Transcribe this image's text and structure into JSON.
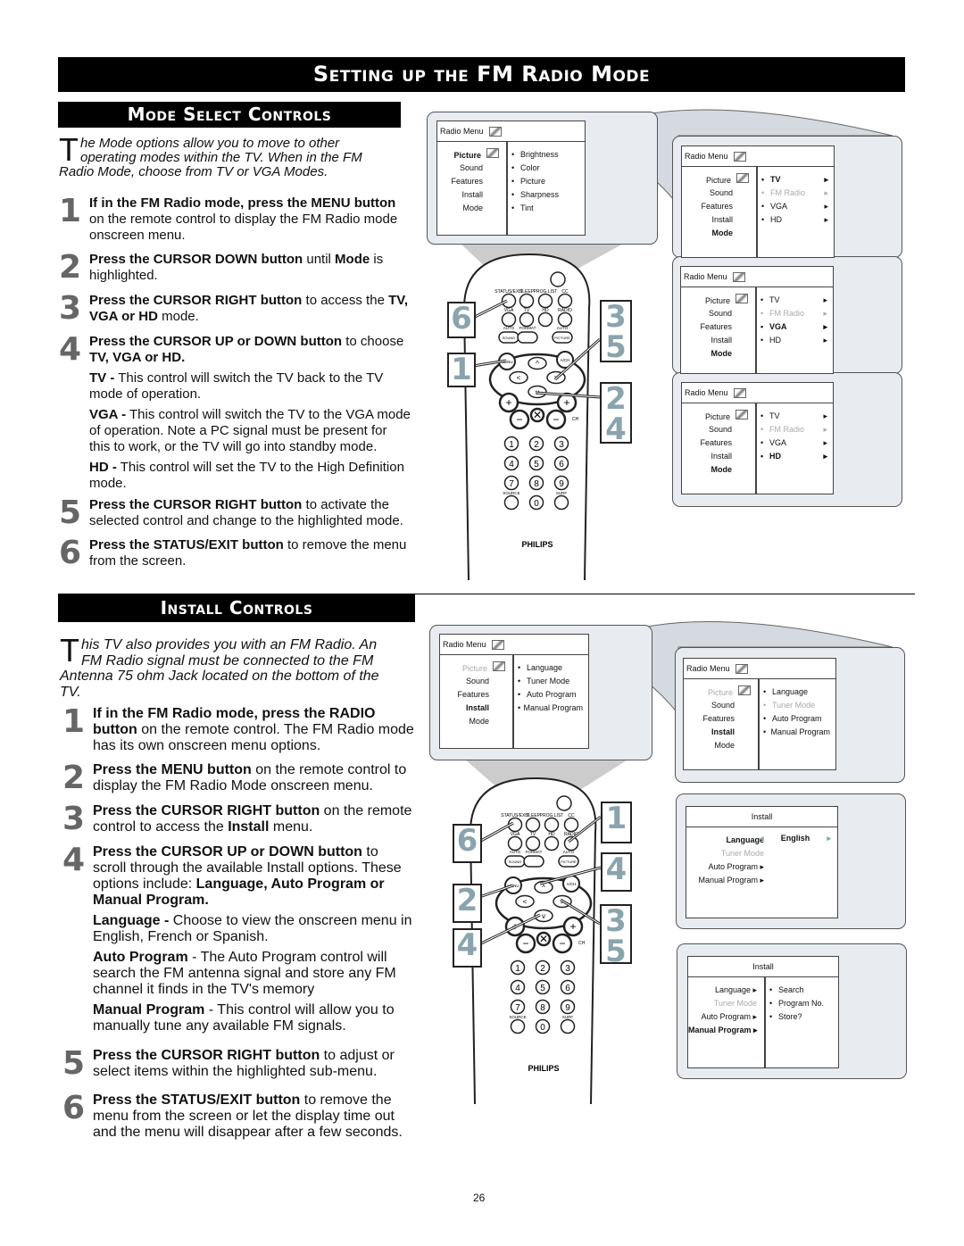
{
  "title": "Setting up the FM Radio Mode",
  "page_number": "26",
  "section1": {
    "heading": "Mode Select Controls",
    "intro_cap": "T",
    "intro": "he Mode options allow you to move to other operating modes within the TV. When in the FM Radio Mode, choose from TV or VGA Modes.",
    "steps": [
      {
        "n": "1",
        "paras": [
          [
            [
              "If in the FM Radio mode, press the MENU button",
              1
            ],
            [
              " on the remote control to display the FM Radio mode onscreen menu.",
              0
            ]
          ]
        ]
      },
      {
        "n": "2",
        "paras": [
          [
            [
              "Press the CURSOR DOWN button",
              1
            ],
            [
              " until ",
              0
            ],
            [
              "Mode",
              1
            ],
            [
              " is highlighted.",
              0
            ]
          ]
        ]
      },
      {
        "n": "3",
        "paras": [
          [
            [
              "Press the CURSOR RIGHT button",
              1
            ],
            [
              " to access the ",
              0
            ],
            [
              "TV, VGA or HD",
              1
            ],
            [
              " mode.",
              0
            ]
          ]
        ]
      },
      {
        "n": "4",
        "paras": [
          [
            [
              "Press the CURSOR UP or DOWN button",
              1
            ],
            [
              " to choose ",
              0
            ],
            [
              "TV, VGA or HD.",
              1
            ]
          ],
          [
            [
              "TV -",
              1
            ],
            [
              " This control will switch the TV back to the TV mode of operation.",
              0
            ]
          ],
          [
            [
              "VGA -",
              1
            ],
            [
              " This control will switch the TV  to the VGA mode of operation. Note a PC signal must be present for this to work, or the TV will go into standby mode.",
              0
            ]
          ],
          [
            [
              "HD -",
              1
            ],
            [
              " This control will set the TV to the High Definition mode.",
              0
            ]
          ]
        ]
      },
      {
        "n": "5",
        "paras": [
          [
            [
              "Press the CURSOR RIGHT button",
              1
            ],
            [
              " to activate the selected control and change to the highlighted mode.",
              0
            ]
          ]
        ]
      },
      {
        "n": "6",
        "paras": [
          [
            [
              "Press the STATUS/EXIT button",
              1
            ],
            [
              " to remove the menu from the screen.",
              0
            ]
          ]
        ]
      }
    ]
  },
  "section2": {
    "heading": "Install Controls",
    "intro_cap": "T",
    "intro": "his TV also provides you with an FM Radio. An FM Radio signal must be connected to the FM Antenna 75 ohm Jack located on the bottom of the TV.",
    "steps": [
      {
        "n": "1",
        "paras": [
          [
            [
              "If in the FM Radio mode, press the RADIO button",
              1
            ],
            [
              " on the remote control. The FM Radio mode has its own onscreen menu options.",
              0
            ]
          ]
        ]
      },
      {
        "n": "2",
        "paras": [
          [
            [
              "Press the MENU button",
              1
            ],
            [
              " on the remote control to display the FM Radio Mode onscreen menu.",
              0
            ]
          ]
        ]
      },
      {
        "n": "3",
        "paras": [
          [
            [
              "Press the CURSOR RIGHT button",
              1
            ],
            [
              " on the remote control to access the ",
              0
            ],
            [
              "Install",
              1
            ],
            [
              " menu.",
              0
            ]
          ]
        ]
      },
      {
        "n": "4",
        "paras": [
          [
            [
              "Press the CURSOR UP or DOWN button",
              1
            ],
            [
              " to scroll through the available Install options. These options include: ",
              0
            ],
            [
              "Language, Auto Program or Manual Program.",
              1
            ]
          ],
          [
            [
              "Language -",
              1
            ],
            [
              " Choose to view the onscreen menu in English, French or Spanish.",
              0
            ]
          ],
          [
            [
              "Auto Program",
              1
            ],
            [
              " - The Auto Program control will search the FM antenna signal and store any FM channel it finds in the TV's memory",
              0
            ]
          ],
          [
            [
              "Manual Program",
              1
            ],
            [
              " - This control will allow you to manually tune any available FM signals.",
              0
            ]
          ]
        ]
      },
      {
        "n": "5",
        "paras": [
          [
            [
              "Press the CURSOR RIGHT button",
              1
            ],
            [
              " to adjust or select items within the highlighted sub-menu.",
              0
            ]
          ]
        ]
      },
      {
        "n": "6",
        "paras": [
          [
            [
              "Press the STATUS/EXIT button",
              1
            ],
            [
              " to remove the menu from the screen or let the display time out and the menu will disappear after a few seconds.",
              0
            ]
          ]
        ]
      }
    ]
  },
  "menus": [
    {
      "title": "Radio Menu",
      "icon": true,
      "left": [
        [
          "Picture",
          "b"
        ],
        [
          "Sound",
          "n"
        ],
        [
          "Features",
          "n"
        ],
        [
          "Install",
          "n"
        ],
        [
          "Mode",
          "n"
        ]
      ],
      "right": [
        [
          "Brightness",
          "n",
          false
        ],
        [
          "Color",
          "n",
          false
        ],
        [
          "Picture",
          "n",
          false
        ],
        [
          "Sharpness",
          "n",
          false
        ],
        [
          "Tint",
          "n",
          false
        ]
      ]
    },
    {
      "title": "Radio Menu",
      "icon": true,
      "left": [
        [
          "Picture",
          "n"
        ],
        [
          "Sound",
          "n"
        ],
        [
          "Features",
          "n"
        ],
        [
          "Install",
          "n"
        ],
        [
          "Mode",
          "b"
        ]
      ],
      "right": [
        [
          "TV",
          "b",
          true
        ],
        [
          "FM Radio",
          "d",
          true
        ],
        [
          "VGA",
          "n",
          true
        ],
        [
          "HD",
          "n",
          true
        ]
      ]
    },
    {
      "title": "Radio Menu",
      "icon": true,
      "left": [
        [
          "Picture",
          "n"
        ],
        [
          "Sound",
          "n"
        ],
        [
          "Features",
          "n"
        ],
        [
          "Install",
          "n"
        ],
        [
          "Mode",
          "b"
        ]
      ],
      "right": [
        [
          "TV",
          "n",
          true
        ],
        [
          "FM Radio",
          "d",
          true
        ],
        [
          "VGA",
          "b",
          true
        ],
        [
          "HD",
          "n",
          true
        ]
      ]
    },
    {
      "title": "Radio Menu",
      "icon": true,
      "left": [
        [
          "Picture",
          "n"
        ],
        [
          "Sound",
          "n"
        ],
        [
          "Features",
          "n"
        ],
        [
          "Install",
          "n"
        ],
        [
          "Mode",
          "b"
        ]
      ],
      "right": [
        [
          "TV",
          "n",
          true
        ],
        [
          "FM Radio",
          "d",
          true
        ],
        [
          "VGA",
          "n",
          true
        ],
        [
          "HD",
          "b",
          true
        ]
      ]
    },
    {
      "title": "Radio Menu",
      "icon": true,
      "left": [
        [
          "Picture",
          "d"
        ],
        [
          "Sound",
          "n"
        ],
        [
          "Features",
          "n"
        ],
        [
          "Install",
          "b"
        ],
        [
          "Mode",
          "n"
        ]
      ],
      "right": [
        [
          "Language",
          "n",
          false
        ],
        [
          "Tuner Mode",
          "n",
          false
        ],
        [
          "Auto Program",
          "n",
          false
        ],
        [
          "Manual Program",
          "n",
          false
        ]
      ]
    },
    {
      "title": "Radio Menu",
      "icon": true,
      "left": [
        [
          "Picture",
          "d"
        ],
        [
          "Sound",
          "n"
        ],
        [
          "Features",
          "n"
        ],
        [
          "Install",
          "b"
        ],
        [
          "Mode",
          "n"
        ]
      ],
      "right": [
        [
          "Language",
          "n",
          false
        ],
        [
          "Tuner Mode",
          "d",
          false
        ],
        [
          "Auto Program",
          "n",
          false
        ],
        [
          "Manual Program",
          "n",
          false
        ]
      ]
    },
    {
      "title": "Install",
      "icon": false,
      "value": "English",
      "left": [
        [
          "Language",
          "b"
        ],
        [
          "Tuner Mode",
          "d"
        ],
        [
          "Auto Program ▸",
          "n"
        ],
        [
          "Manual Program ▸",
          "n"
        ]
      ],
      "right": []
    },
    {
      "title": "Install",
      "icon": false,
      "left": [
        [
          "Language ▸",
          "n"
        ],
        [
          "Tuner Mode",
          "d"
        ],
        [
          "Auto Program ▸",
          "n"
        ],
        [
          "Manual Program ▸",
          "b"
        ]
      ],
      "right": [
        [
          "Search",
          "n",
          false
        ],
        [
          "Program No.",
          "n",
          false
        ],
        [
          "Store?",
          "n",
          false
        ]
      ]
    }
  ],
  "remote": {
    "labels": [
      "STATUS/EXIT",
      "SLEEP",
      "PROG.LIST",
      "CC",
      "VGA",
      "TV",
      "HD",
      "RADIO",
      "AUTO",
      "FORMAT",
      "AUTO"
    ],
    "sound": "SOUND",
    "picture": "PICTURE",
    "menu": "MENU",
    "ach": "A/CH",
    "ch": "CH",
    "source": "SOURCE",
    "surf": "SURF",
    "digits": [
      "1",
      "2",
      "3",
      "4",
      "5",
      "6",
      "7",
      "8",
      "9",
      "0"
    ],
    "brand": "PHILIPS"
  },
  "callouts_top": [
    "6",
    "1",
    "3 5",
    "2 4"
  ],
  "callouts_bottom": [
    "6",
    "2",
    "4",
    "1",
    "4",
    "3 5"
  ],
  "colors": {
    "panel": "#e8ecf0",
    "callout_number": "#8aa4ad",
    "step_number": "#666666"
  }
}
